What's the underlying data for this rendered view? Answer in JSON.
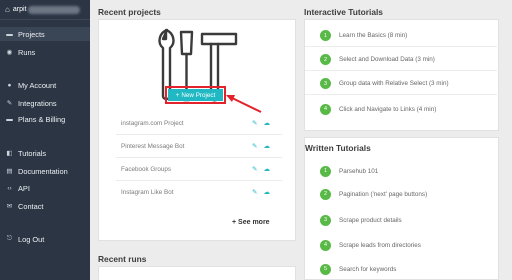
{
  "user": {
    "name": "arpit"
  },
  "sidebar": {
    "items": [
      {
        "label": "Projects",
        "icon": "folder-icon",
        "glyph": "▬"
      },
      {
        "label": "Runs",
        "icon": "runs-icon",
        "glyph": "◉"
      },
      {
        "label": "My Account",
        "icon": "user-icon",
        "glyph": "●"
      },
      {
        "label": "Integrations",
        "icon": "plug-icon",
        "glyph": "✎"
      },
      {
        "label": "Plans & Billing",
        "icon": "billing-icon",
        "glyph": "▬"
      },
      {
        "label": "Tutorials",
        "icon": "book-icon",
        "glyph": "◧"
      },
      {
        "label": "Documentation",
        "icon": "docs-icon",
        "glyph": "▤"
      },
      {
        "label": "API",
        "icon": "code-icon",
        "glyph": "‹›"
      },
      {
        "label": "Contact",
        "icon": "envelope-icon",
        "glyph": "✉"
      },
      {
        "label": "Log Out",
        "icon": "logout-icon",
        "glyph": "⎋"
      }
    ]
  },
  "recent_projects": {
    "title": "Recent projects",
    "new_project_label": "New Project",
    "projects": [
      {
        "name": "instagram.com Project"
      },
      {
        "name": "Pinterest Message Bot"
      },
      {
        "name": "Facebook Groups"
      },
      {
        "name": "Instagram Like Bot"
      }
    ],
    "see_more_label": "See more"
  },
  "recent_runs": {
    "title": "Recent runs"
  },
  "interactive_tutorials": {
    "title": "Interactive Tutorials",
    "items": [
      {
        "num": "1",
        "label": "Learn the Basics (8 min)"
      },
      {
        "num": "2",
        "label": "Select and Download Data (3 min)"
      },
      {
        "num": "3",
        "label": "Group data with Relative Select (3 min)"
      },
      {
        "num": "4",
        "label": "Click and Navigate to Links (4 min)"
      }
    ]
  },
  "written_tutorials": {
    "title": "Written Tutorials",
    "items": [
      {
        "num": "1",
        "label": "Parsehub 101"
      },
      {
        "num": "2",
        "label": "Pagination ('next' page buttons)"
      },
      {
        "num": "3",
        "label": "Scrape product details"
      },
      {
        "num": "4",
        "label": "Scrape leads from directories"
      },
      {
        "num": "5",
        "label": "Search for keywords"
      }
    ]
  },
  "colors": {
    "accent": "#20b9c3",
    "highlight": "#e3222b",
    "badge": "#58b946",
    "sidebar": "#2b3544"
  }
}
